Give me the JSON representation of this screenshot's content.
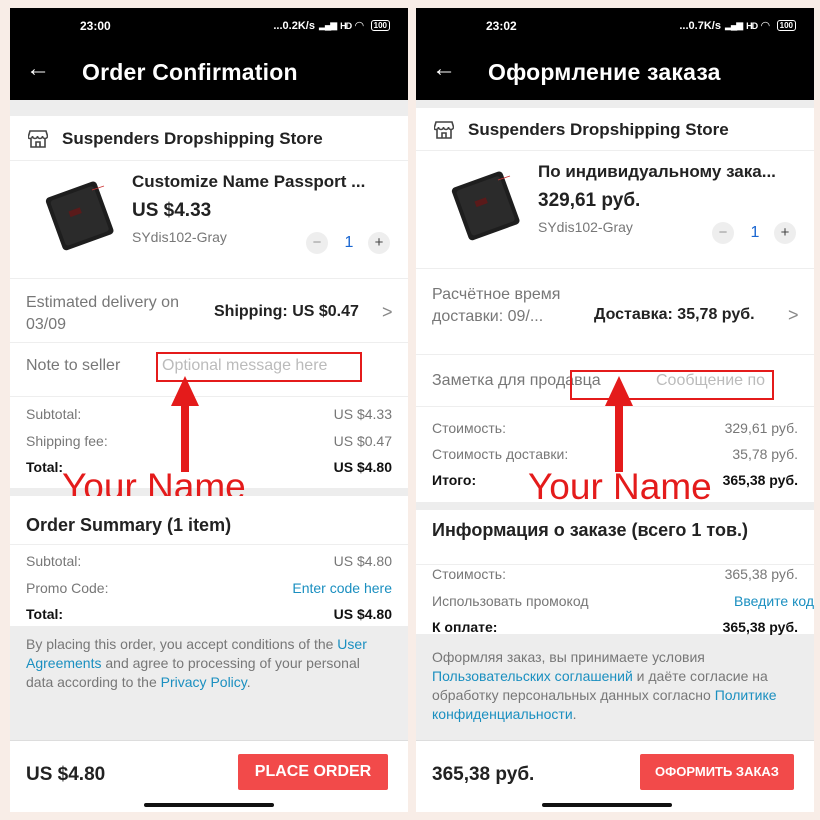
{
  "colors": {
    "accent_red": "#f24a4a",
    "annotation_red": "#e41b1b",
    "link_blue": "#1a8fc0",
    "qty_blue": "#1a66d1"
  },
  "left": {
    "status": {
      "time": "23:00",
      "speed": "...0.2K/s",
      "network": "HD",
      "battery": "100"
    },
    "title": "Order Confirmation",
    "store_name": "Suspenders Dropshipping Store",
    "product": {
      "name": "Customize Name Passport ...",
      "price": "US $4.33",
      "sku": "SYdis102-Gray",
      "qty_minus": "−",
      "qty": "1",
      "qty_plus": "+"
    },
    "delivery": {
      "label": "Estimated delivery on 03/09",
      "shipping": "Shipping: US $0.47",
      "chevron": ">"
    },
    "note": {
      "label": "Note to seller",
      "placeholder": "Optional message here"
    },
    "summary": [
      {
        "label": "Subtotal:",
        "value": "US $4.33"
      },
      {
        "label": "Shipping fee:",
        "value": "US $0.47"
      },
      {
        "label": "Total:",
        "value": "US $4.80"
      }
    ],
    "annotation": "Your Name",
    "order_summary": {
      "title": "Order Summary (1 item)",
      "subtotal_label": "Subtotal:",
      "subtotal_value": "US $4.80",
      "promo_label": "Promo Code:",
      "promo_value": "Enter code here",
      "total_label": "Total:",
      "total_value": "US $4.80"
    },
    "legal": {
      "p1": "By placing this order, you accept conditions of the ",
      "link1": "User Agreements",
      "p2": " and agree to processing of your personal data according to the ",
      "link2": "Privacy Policy",
      "p3": "."
    },
    "bottom": {
      "total": "US $4.80",
      "button": "PLACE ORDER"
    }
  },
  "right": {
    "status": {
      "time": "23:02",
      "speed": "...0.7K/s",
      "network": "HD",
      "battery": "100"
    },
    "title": "Оформление заказа",
    "store_name": "Suspenders Dropshipping Store",
    "product": {
      "name": "По индивидуальному зака...",
      "price": "329,61 руб.",
      "sku": "SYdis102-Gray",
      "qty_minus": "−",
      "qty": "1",
      "qty_plus": "+"
    },
    "delivery": {
      "label": "Расчётное время доставки: 09/...",
      "shipping": "Доставка: 35,78 руб.",
      "chevron": ">"
    },
    "note": {
      "label": "Заметка для продавца",
      "placeholder": "Сообщение по"
    },
    "summary": [
      {
        "label": "Стоимость:",
        "value": "329,61 руб."
      },
      {
        "label": "Стоимость доставки:",
        "value": "35,78 руб."
      },
      {
        "label": "Итого:",
        "value": "365,38 руб."
      }
    ],
    "annotation": "Your Name",
    "order_summary": {
      "title": "Информация о заказе (всего 1 тов.)",
      "subtotal_label": "Стоимость:",
      "subtotal_value": "365,38 руб.",
      "promo_label": "Использовать промокод",
      "promo_value": "Введите код",
      "total_label": "К оплате:",
      "total_value": "365,38 руб."
    },
    "legal": {
      "p1": "Оформляя заказ, вы принимаете условия ",
      "link1": "Пользовательских соглашений",
      "p2": " и даёте согласие на обработку персональных данных согласно ",
      "link2": "Политике конфиденциальности",
      "p3": "."
    },
    "bottom": {
      "total": "365,38 руб.",
      "button": "ОФОРМИТЬ ЗАКАЗ"
    }
  }
}
